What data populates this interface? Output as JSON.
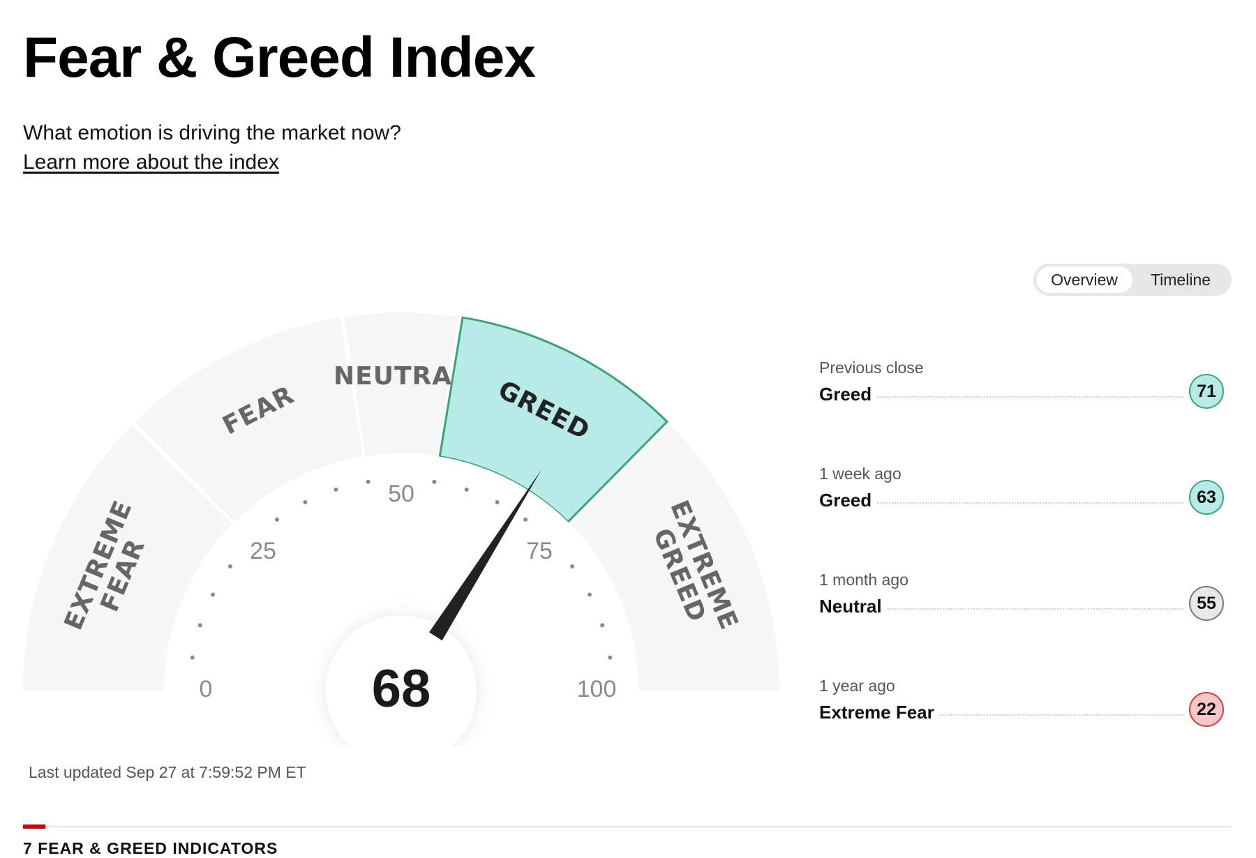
{
  "header": {
    "title": "Fear & Greed Index",
    "subtitle": "What emotion is driving the market now?",
    "learn_link": "Learn more about the index"
  },
  "toggle": {
    "options": [
      {
        "label": "Overview",
        "active": true
      },
      {
        "label": "Timeline",
        "active": false
      }
    ]
  },
  "gauge": {
    "value": 68,
    "value_label": "68",
    "scale_min": 0,
    "scale_max": 100,
    "active_zone": "GREED",
    "zones": [
      {
        "from": 0,
        "to": 25,
        "lines": [
          "EXTREME",
          "FEAR"
        ]
      },
      {
        "from": 25,
        "to": 45,
        "lines": [
          "FEAR"
        ]
      },
      {
        "from": 45,
        "to": 55,
        "lines": [
          "NEUTRAL"
        ]
      },
      {
        "from": 55,
        "to": 75,
        "lines": [
          "GREED"
        ]
      },
      {
        "from": 75,
        "to": 100,
        "lines": [
          "EXTREME",
          "GREED"
        ]
      }
    ],
    "tick_labels": [
      "0",
      "25",
      "50",
      "75",
      "100"
    ],
    "colors": {
      "zone_bg": "#f6f6f6",
      "active_fill": "#b8ebe7",
      "active_stroke": "#3aa574",
      "needle": "#222222",
      "tick": "#8a8a8a"
    }
  },
  "history": [
    {
      "label": "Previous close",
      "rating": "Greed",
      "value": "71",
      "color": "#b8ebe7",
      "border": "#3aa574"
    },
    {
      "label": "1 week ago",
      "rating": "Greed",
      "value": "63",
      "color": "#b8ebe7",
      "border": "#3aa574"
    },
    {
      "label": "1 month ago",
      "rating": "Neutral",
      "value": "55",
      "color": "#e8e8e8",
      "border": "#777777"
    },
    {
      "label": "1 year ago",
      "rating": "Extreme Fear",
      "value": "22",
      "color": "#f7c6c6",
      "border": "#d13b3b"
    }
  ],
  "last_updated": "Last updated Sep 27 at 7:59:52 PM ET",
  "indicators_heading": "7 FEAR & GREED INDICATORS"
}
